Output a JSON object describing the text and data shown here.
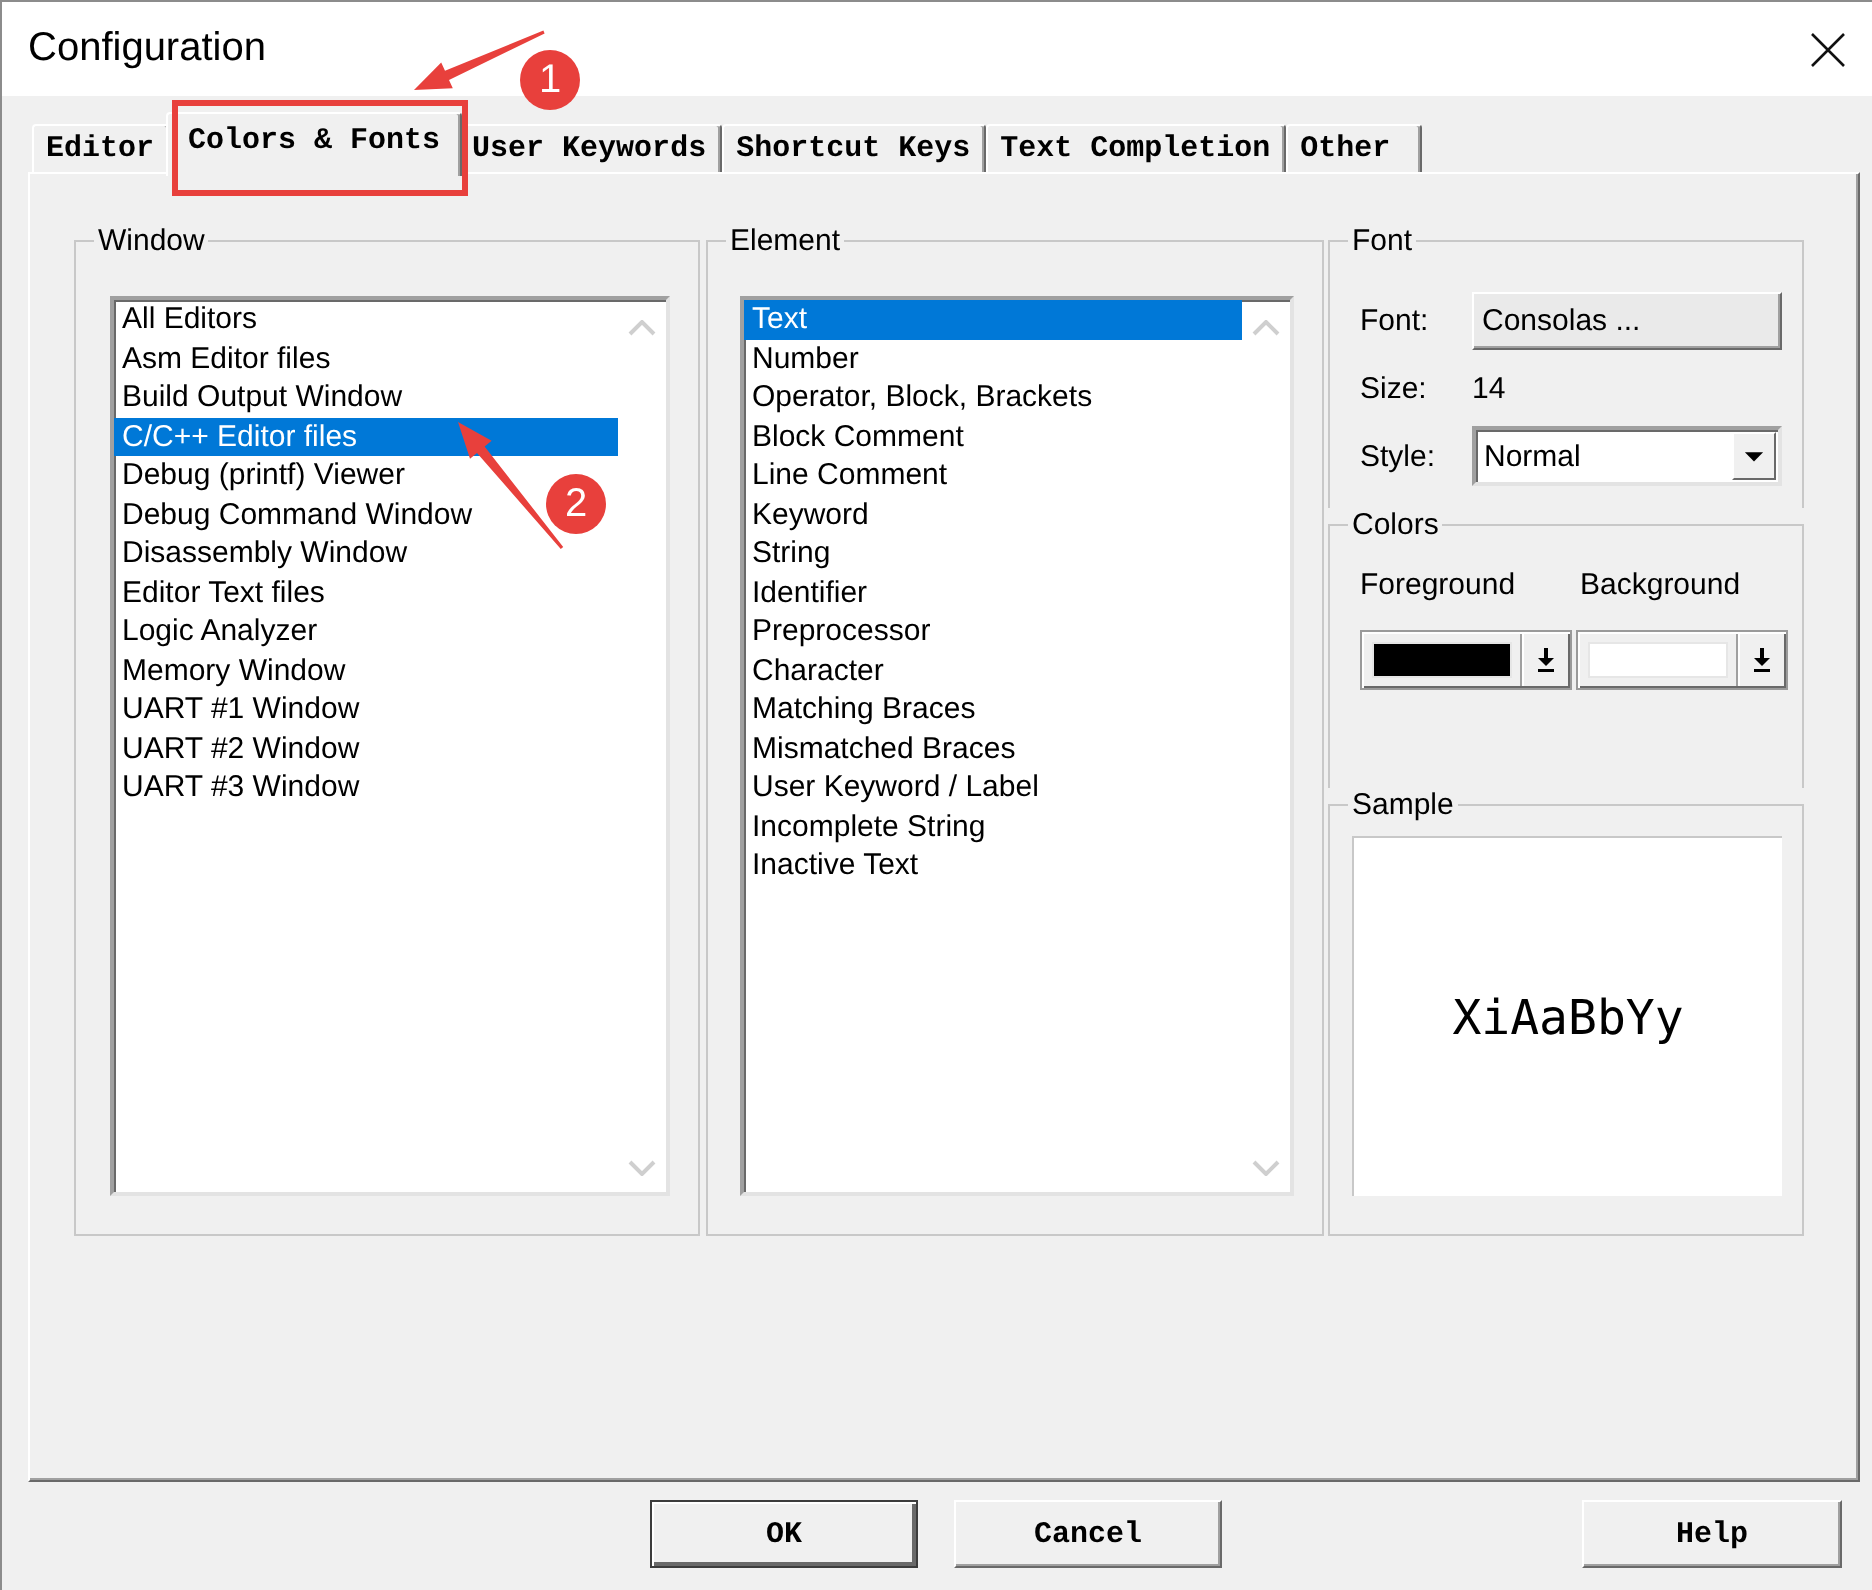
{
  "window": {
    "title": "Configuration"
  },
  "tabs": [
    {
      "label": "Editor",
      "selected": false,
      "highlighted": false
    },
    {
      "label": "Colors & Fonts",
      "selected": true,
      "highlighted": true
    },
    {
      "label": "User Keywords",
      "selected": false,
      "highlighted": false
    },
    {
      "label": "Shortcut Keys",
      "selected": false,
      "highlighted": false
    },
    {
      "label": "Text Completion",
      "selected": false,
      "highlighted": false
    },
    {
      "label": "Other",
      "selected": false,
      "highlighted": false
    }
  ],
  "window_group": {
    "title": "Window",
    "items": [
      {
        "label": "All Editors",
        "selected": false
      },
      {
        "label": "Asm Editor files",
        "selected": false
      },
      {
        "label": "Build Output Window",
        "selected": false
      },
      {
        "label": "C/C++ Editor files",
        "selected": true
      },
      {
        "label": "Debug (printf) Viewer",
        "selected": false
      },
      {
        "label": "Debug Command Window",
        "selected": false
      },
      {
        "label": "Disassembly Window",
        "selected": false
      },
      {
        "label": "Editor Text files",
        "selected": false
      },
      {
        "label": "Logic Analyzer",
        "selected": false
      },
      {
        "label": "Memory Window",
        "selected": false
      },
      {
        "label": "UART #1 Window",
        "selected": false
      },
      {
        "label": "UART #2 Window",
        "selected": false
      },
      {
        "label": "UART #3 Window",
        "selected": false
      }
    ]
  },
  "element_group": {
    "title": "Element",
    "items": [
      {
        "label": "Text",
        "selected": true
      },
      {
        "label": "Number",
        "selected": false
      },
      {
        "label": "Operator, Block, Brackets",
        "selected": false
      },
      {
        "label": "Block Comment",
        "selected": false
      },
      {
        "label": "Line Comment",
        "selected": false
      },
      {
        "label": "Keyword",
        "selected": false
      },
      {
        "label": "String",
        "selected": false
      },
      {
        "label": "Identifier",
        "selected": false
      },
      {
        "label": "Preprocessor",
        "selected": false
      },
      {
        "label": "Character",
        "selected": false
      },
      {
        "label": "Matching Braces",
        "selected": false
      },
      {
        "label": "Mismatched Braces",
        "selected": false
      },
      {
        "label": "User Keyword / Label",
        "selected": false
      },
      {
        "label": "Incomplete String",
        "selected": false
      },
      {
        "label": "Inactive Text",
        "selected": false
      }
    ]
  },
  "font_group": {
    "title": "Font",
    "font_label": "Font:",
    "font_button": "Consolas ...",
    "size_label": "Size:",
    "size_value": "14",
    "style_label": "Style:",
    "style_value": "Normal"
  },
  "colors_group": {
    "title": "Colors",
    "pickers": [
      {
        "label": "Foreground",
        "color": "#000000"
      },
      {
        "label": "Background",
        "color": "#ffffff"
      }
    ]
  },
  "sample_group": {
    "title": "Sample",
    "text": "XiAaBbYy"
  },
  "buttons": [
    {
      "label": "OK",
      "default": true
    },
    {
      "label": "Cancel",
      "default": false
    },
    {
      "label": "Help",
      "default": false
    }
  ],
  "annotations": [
    {
      "number": "1"
    },
    {
      "number": "2"
    }
  ]
}
